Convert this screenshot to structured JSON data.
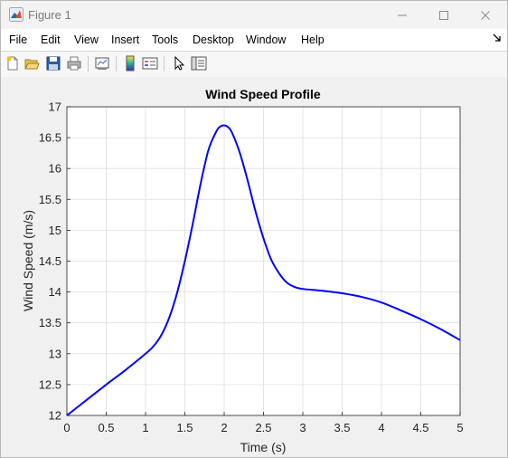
{
  "window": {
    "title": "Figure 1",
    "minimize_icon": "minimize-icon",
    "maximize_icon": "maximize-icon",
    "close_icon": "close-icon"
  },
  "menu": {
    "items": [
      "File",
      "Edit",
      "View",
      "Insert",
      "Tools",
      "Desktop",
      "Window",
      "Help"
    ],
    "dock_icon": "dock-arrow-icon"
  },
  "toolbar": {
    "buttons": [
      "new-figure-icon",
      "open-file-icon",
      "save-icon",
      "print-icon",
      "link-plot-icon",
      "colorbar-icon",
      "legend-icon",
      "pointer-arrow-icon",
      "property-inspector-icon"
    ]
  },
  "chart_data": {
    "type": "line",
    "title": "Wind Speed Profile",
    "xlabel": "Time (s)",
    "ylabel": "Wind Speed (m/s)",
    "xlim": [
      0,
      5
    ],
    "ylim": [
      12,
      17
    ],
    "xticks": [
      "0",
      "0.5",
      "1",
      "1.5",
      "2",
      "2.5",
      "3",
      "3.5",
      "4",
      "4.5",
      "5"
    ],
    "yticks": [
      "12",
      "12.5",
      "13",
      "13.5",
      "14",
      "14.5",
      "15",
      "15.5",
      "16",
      "16.5",
      "17"
    ],
    "grid": true,
    "series": [
      {
        "color": "#0000ff",
        "x": [
          0,
          0.25,
          0.5,
          0.75,
          1.0,
          1.1,
          1.2,
          1.3,
          1.4,
          1.5,
          1.6,
          1.7,
          1.8,
          1.9,
          1.95,
          2.0,
          2.05,
          2.1,
          2.2,
          2.3,
          2.4,
          2.5,
          2.6,
          2.7,
          2.8,
          2.9,
          3.0,
          3.25,
          3.5,
          3.75,
          4.0,
          4.25,
          4.5,
          4.75,
          5.0
        ],
        "y": [
          12.0,
          12.25,
          12.5,
          12.74,
          13.0,
          13.12,
          13.3,
          13.58,
          13.98,
          14.5,
          15.1,
          15.75,
          16.3,
          16.6,
          16.68,
          16.7,
          16.67,
          16.58,
          16.25,
          15.8,
          15.3,
          14.87,
          14.52,
          14.3,
          14.15,
          14.08,
          14.05,
          14.02,
          13.98,
          13.92,
          13.83,
          13.7,
          13.56,
          13.4,
          13.22
        ]
      }
    ]
  }
}
